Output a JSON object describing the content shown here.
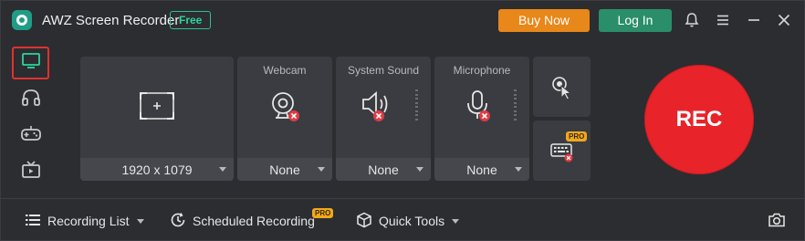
{
  "titlebar": {
    "app_title": "AWZ Screen Recorder",
    "badge": "Free",
    "buy_label": "Buy Now",
    "login_label": "Log In",
    "icons": [
      "bell-icon",
      "menu-icon",
      "minimize-icon",
      "close-icon"
    ]
  },
  "nav": {
    "items": [
      {
        "name": "screen",
        "icon": "monitor-icon",
        "active": true
      },
      {
        "name": "audio",
        "icon": "headphones-icon",
        "active": false
      },
      {
        "name": "game",
        "icon": "gamepad-icon",
        "active": false
      },
      {
        "name": "tv",
        "icon": "tv-icon",
        "active": false
      }
    ]
  },
  "capture": {
    "area_value": "1920 x 1079"
  },
  "webcam": {
    "label": "Webcam",
    "value": "None"
  },
  "system_sound": {
    "label": "System Sound",
    "value": "None"
  },
  "microphone": {
    "label": "Microphone",
    "value": "None"
  },
  "tools": {
    "pro_badge": "PRO"
  },
  "rec": {
    "label": "REC"
  },
  "bottom": {
    "recording_list": "Recording List",
    "scheduled_recording": "Scheduled Recording",
    "scheduled_pro": "PRO",
    "quick_tools": "Quick Tools"
  },
  "colors": {
    "accent_green": "#2fd49a",
    "buy_orange": "#e8871a",
    "login_green": "#2b8e6b",
    "rec_red": "#e8232a",
    "disabled_red": "#e03b44"
  }
}
